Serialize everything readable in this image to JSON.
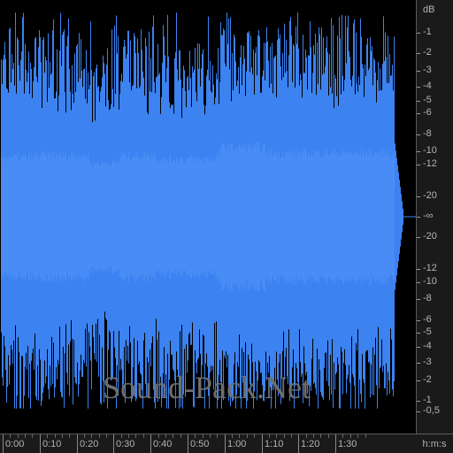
{
  "app": {
    "watermark": "Sound-Pack.Net"
  },
  "colors": {
    "background": "#000000",
    "waveform": "#3c82f0",
    "ruler_background": "#1a1a1a",
    "ruler_text": "#b4b4b4"
  },
  "db_ruler": {
    "unit": "dB",
    "labels": [
      "-1",
      "-2",
      "-3",
      "-4",
      "-5",
      "-6",
      "-8",
      "-10",
      "-12",
      "-20",
      "-∞",
      "-20",
      "-12",
      "-10",
      "-8",
      "-6",
      "-5",
      "-4",
      "-3",
      "-2",
      "-1",
      "-0,5"
    ],
    "db_values": [
      -1,
      -2,
      -3,
      -4,
      -5,
      -6,
      -8,
      -10,
      -12,
      -20,
      null,
      -20,
      -12,
      -10,
      -8,
      -6,
      -5,
      -4,
      -3,
      -2,
      -1,
      -0.5
    ],
    "channel": [
      "top",
      "top",
      "top",
      "top",
      "top",
      "top",
      "top",
      "top",
      "top",
      "top",
      "center",
      "bottom",
      "bottom",
      "bottom",
      "bottom",
      "bottom",
      "bottom",
      "bottom",
      "bottom",
      "bottom",
      "bottom",
      "bottom"
    ]
  },
  "time_ruler": {
    "unit": "h:m:s",
    "labels": [
      "0:00",
      "0:10",
      "0:20",
      "0:30",
      "0:40",
      "0:50",
      "1:00",
      "1:10",
      "1:20",
      "1:30"
    ],
    "seconds": [
      0,
      10,
      20,
      30,
      40,
      50,
      60,
      70,
      80,
      90
    ],
    "total_seconds": 106
  }
}
